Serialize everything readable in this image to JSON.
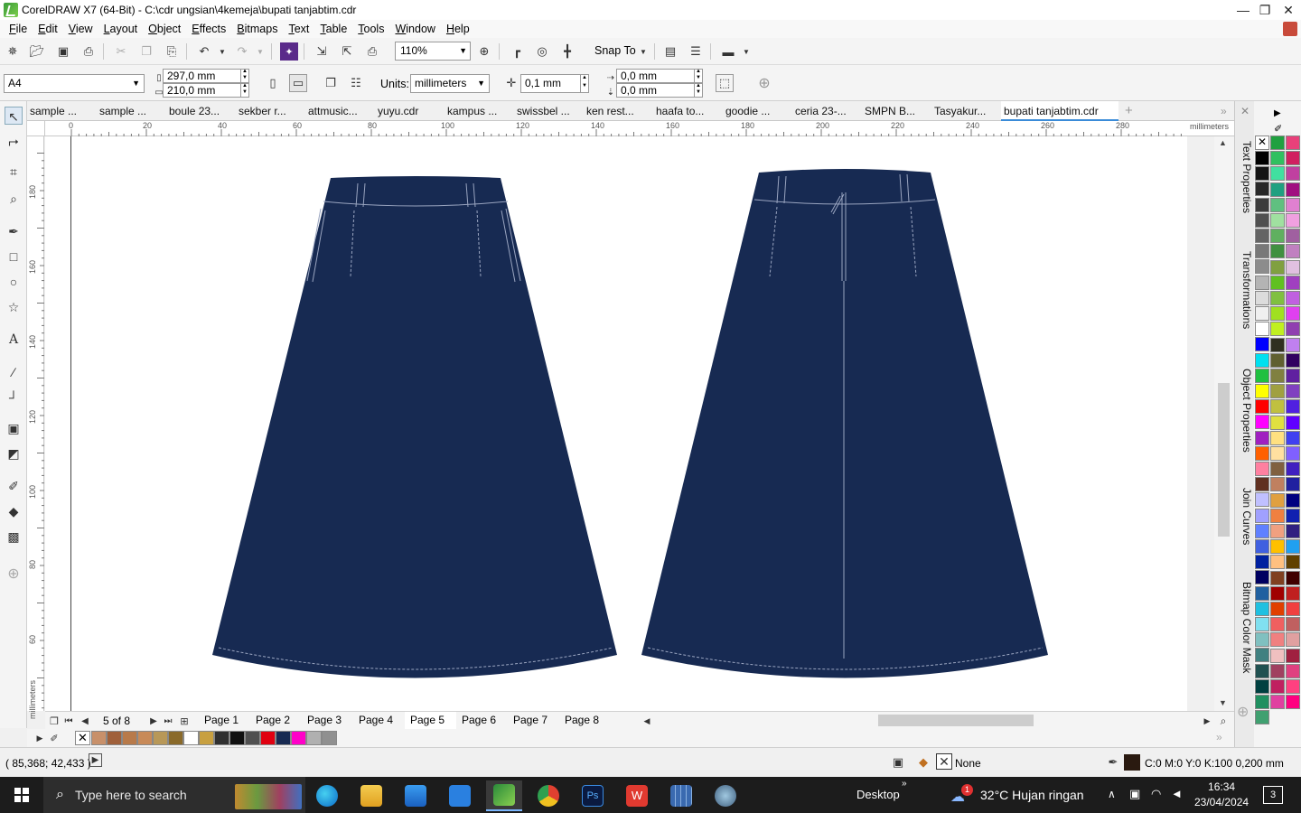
{
  "window": {
    "title": "CorelDRAW X7 (64-Bit) - C:\\cdr ungsian\\4kemeja\\bupati tanjabtim.cdr",
    "minimize": "—",
    "maximize": "❐",
    "close": "✕"
  },
  "menu": [
    "File",
    "Edit",
    "View",
    "Layout",
    "Object",
    "Effects",
    "Bitmaps",
    "Text",
    "Table",
    "Tools",
    "Window",
    "Help"
  ],
  "toolbar": {
    "zoom": "110%",
    "snap_to": "Snap To"
  },
  "property_bar": {
    "page_size": "A4",
    "width": "297,0 mm",
    "height": "210,0 mm",
    "units_label": "Units:",
    "units": "millimeters",
    "nudge": "0,1 mm",
    "dup_x": "0,0 mm",
    "dup_y": "0,0 mm"
  },
  "doc_tabs": [
    "sample ...",
    "sample ...",
    "boule 23...",
    "sekber r...",
    "attmusic...",
    "yuyu.cdr",
    "kampus ...",
    "swissbel ...",
    "ken rest...",
    "haafa to...",
    "goodie ...",
    "ceria 23-...",
    "SMPN B...",
    "Tasyakur...",
    "bupati tanjabtim.cdr"
  ],
  "ruler": {
    "units": "millimeters",
    "h_ticks": [
      "0",
      "20",
      "40",
      "60",
      "80",
      "100",
      "120",
      "140",
      "160",
      "180",
      "200",
      "220",
      "240",
      "260",
      "280"
    ],
    "v_ticks": [
      "180",
      "160",
      "140",
      "120",
      "100",
      "80",
      "60"
    ],
    "v_units": "millimeters"
  },
  "page_nav": {
    "counter": "5 of 8",
    "pages": [
      "Page 1",
      "Page 2",
      "Page 3",
      "Page 4",
      "Page 5",
      "Page 6",
      "Page 7",
      "Page 8"
    ],
    "active_page": "Page 5"
  },
  "status": {
    "coords": "( 85,368; 42,433 )",
    "fill": "None",
    "outline": "C:0 M:0 Y:0 K:100  0,200 mm"
  },
  "dockers": [
    "Text Properties",
    "Transformations",
    "Object Properties",
    "Join Curves",
    "Bitmap Color Mask"
  ],
  "design": {
    "skirt_color": "#172a52",
    "stitch_color": "#9aa5c0"
  },
  "bottom_palette_colors": [
    "#c8906a",
    "#a0603a",
    "#b87a4a",
    "#c88a58",
    "#b89858",
    "#8a6a2a",
    "#ffffff",
    "#c8a040",
    "#303030",
    "#101010",
    "#505050",
    "#e00010",
    "#172a52",
    "#ff00c8",
    "#b0b0b0",
    "#909090"
  ],
  "right_palette_colors": [
    [
      "#000000",
      "#20a040",
      "#e8407a"
    ],
    [
      "#141414",
      "#30c060",
      "#d02060"
    ],
    [
      "#282828",
      "#40e0a0",
      "#c040a0"
    ],
    [
      "#3c3c3c",
      "#20a080",
      "#a01080"
    ],
    [
      "#505050",
      "#60c080",
      "#e080d0"
    ],
    [
      "#646464",
      "#a0e0a0",
      "#f0a0e0"
    ],
    [
      "#787878",
      "#60b060",
      "#a060a0"
    ],
    [
      "#8c8c8c",
      "#409040",
      "#c080c0"
    ],
    [
      "#b4b4b4",
      "#80a040",
      "#e0c0e0"
    ],
    [
      "#dcdcdc",
      "#60c020",
      "#a040c0"
    ],
    [
      "#f0f0f0",
      "#80c040",
      "#c060e0"
    ],
    [
      "#ffffff",
      "#a0e020",
      "#e040f0"
    ],
    [
      "#0000ff",
      "#c0f020",
      "#9040b0"
    ],
    [
      "#00e0f0",
      "#303020",
      "#c080f0"
    ],
    [
      "#20c040",
      "#606030",
      "#300060"
    ],
    [
      "#ffff00",
      "#808040",
      "#6020a0"
    ],
    [
      "#ff0000",
      "#a0a040",
      "#8040c0"
    ],
    [
      "#ff00ff",
      "#c0c040",
      "#5020e0"
    ],
    [
      "#a020c0",
      "#e0e040",
      "#6000ff"
    ],
    [
      "#ff6000",
      "#ffe080",
      "#4040f0"
    ],
    [
      "#ff80a0",
      "#ffe0a0",
      "#8060ff"
    ],
    [
      "#603020",
      "#806040",
      "#4020c0"
    ],
    [
      "#c0c0ff",
      "#c08060",
      "#2020a0"
    ],
    [
      "#a0a0ff",
      "#e0a040",
      "#000080"
    ],
    [
      "#6080ff",
      "#f08040",
      "#1020b0"
    ],
    [
      "#4060e0",
      "#f0a080",
      "#302080"
    ],
    [
      "#0020a0",
      "#ffc000",
      "#20a0f0"
    ],
    [
      "#000060",
      "#ffc080",
      "#604000"
    ],
    [
      "#2060a0",
      "#804020",
      "#400000"
    ],
    [
      "#20c0e0",
      "#a00000",
      "#c02020"
    ],
    [
      "#80e0f0",
      "#e04000",
      "#f04040"
    ],
    [
      "#80c0c0",
      "#f06060",
      "#c06060"
    ],
    [
      "#408080",
      "#f08080",
      "#e0a0a0"
    ],
    [
      "#205050",
      "#f0c0c0",
      "#a02040"
    ],
    [
      "#004040",
      "#a04060",
      "#e04080"
    ],
    [
      "#209060",
      "#c02060",
      "#ff4080"
    ],
    [
      "#40a070",
      "#e040a0",
      "#ff0080"
    ]
  ],
  "taskbar": {
    "search_placeholder": "Type here to search",
    "desktop": "Desktop",
    "weather": "32°C  Hujan ringan",
    "time": "16:34",
    "date": "23/04/2024",
    "notif_count": "3",
    "weather_badge": "1"
  }
}
